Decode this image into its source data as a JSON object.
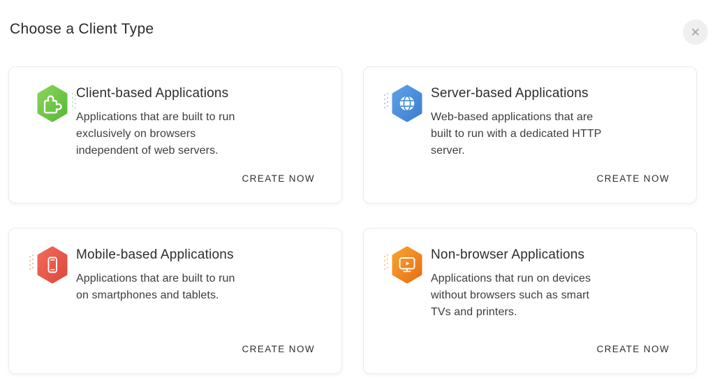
{
  "header": {
    "title": "Choose a Client Type",
    "close_icon_glyph": "✕"
  },
  "annotation": {
    "arrow_color": "#e81313"
  },
  "cards": [
    {
      "title": "Client-based Applications",
      "description": "Applications that are built to run\nexclusively on browsers\nindependent of web servers.",
      "action_label": "CREATE NOW",
      "icon": "puzzle-icon",
      "accent": "#6fc648",
      "accent_light": "#8bd35c",
      "accent_dark": "#57ba33"
    },
    {
      "title": "Server-based Applications",
      "description": "Web-based applications that are\nbuilt to run with a dedicated HTTP\nserver.",
      "action_label": "CREATE NOW",
      "icon": "globe-icon",
      "accent": "#4a8fdb",
      "accent_light": "#5fa0e6",
      "accent_dark": "#3a7fd0"
    },
    {
      "title": "Mobile-based Applications",
      "description": "Applications that are built to run\non smartphones and tablets.",
      "action_label": "CREATE NOW",
      "icon": "smartphone-icon",
      "accent": "#e95a4d",
      "accent_light": "#f06b59",
      "accent_dark": "#de483e"
    },
    {
      "title": "Non-browser Applications",
      "description": "Applications that run on devices\nwithout browsers such as smart\nTVs and printers.",
      "action_label": "CREATE NOW",
      "icon": "tv-play-icon",
      "accent": "#f1881f",
      "accent_light": "#f7a332",
      "accent_dark": "#e96f12"
    }
  ]
}
